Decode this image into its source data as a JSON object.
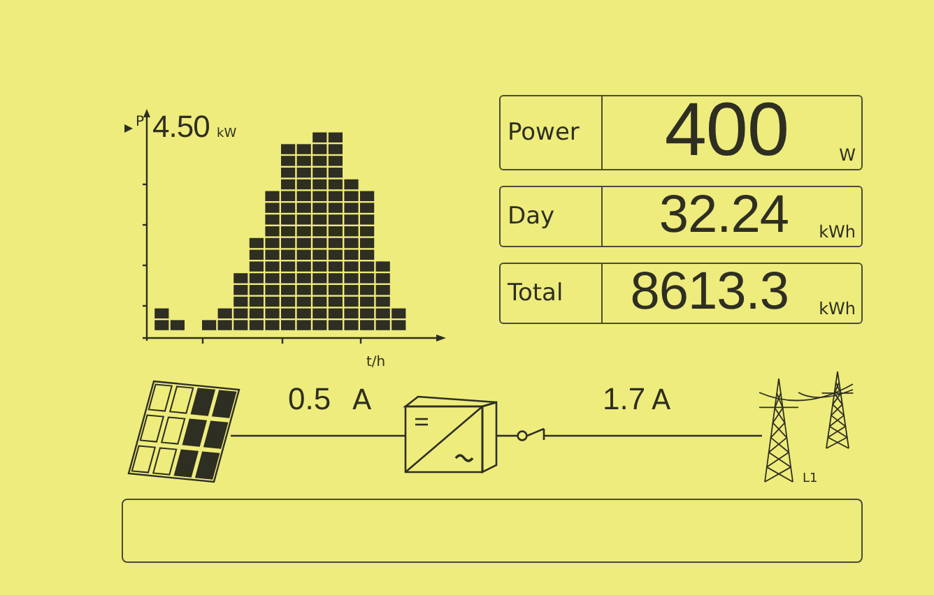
{
  "chart": {
    "y_axis_label": "P",
    "peak_value": "4.50",
    "peak_unit": "kW",
    "x_axis_label": "t/h"
  },
  "readings": [
    {
      "label": "Power",
      "value": "400",
      "unit": "W",
      "kind": "large"
    },
    {
      "label": "Day",
      "value": "32.24",
      "unit": "kWh",
      "kind": "normal"
    },
    {
      "label": "Total",
      "value": "8613.3",
      "unit": "kWh",
      "kind": "normal"
    }
  ],
  "flow": {
    "dc_current": "0.5",
    "dc_unit": "A",
    "ac_current": "1.7",
    "ac_unit": "A",
    "grid_phase": "L1"
  }
}
